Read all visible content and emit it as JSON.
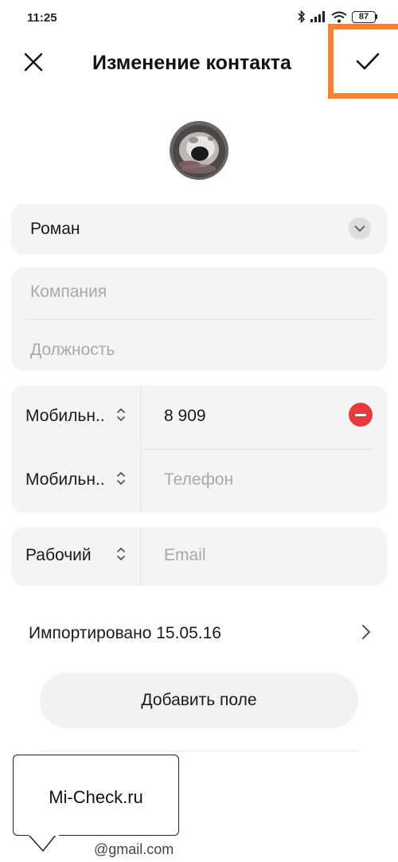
{
  "status_bar": {
    "time": "11:25",
    "battery": "87",
    "icons": [
      "bluetooth-icon",
      "signal-icon",
      "wifi-icon",
      "battery-icon"
    ]
  },
  "header": {
    "title": "Изменение контакта",
    "close_icon": "close-icon",
    "confirm_icon": "checkmark-icon",
    "highlight_color": "#f58233"
  },
  "contact": {
    "name": "Роман",
    "company_placeholder": "Компания",
    "job_placeholder": "Должность"
  },
  "phones": [
    {
      "type": "Мобильн..",
      "value": "8 909"
    },
    {
      "type": "Мобильн..",
      "placeholder": "Телефон"
    }
  ],
  "email": {
    "type": "Рабочий",
    "placeholder": "Email"
  },
  "import": {
    "label": "Импортировано 15.05.16"
  },
  "add_field": {
    "label": "Добавить поле"
  },
  "watermark": {
    "text": "Mi-Check.ru"
  },
  "email_peek": "@gmail.com",
  "colors": {
    "card_bg": "#f4f4f4",
    "remove_red": "#e8393f",
    "placeholder_gray": "#a9a9a9"
  }
}
